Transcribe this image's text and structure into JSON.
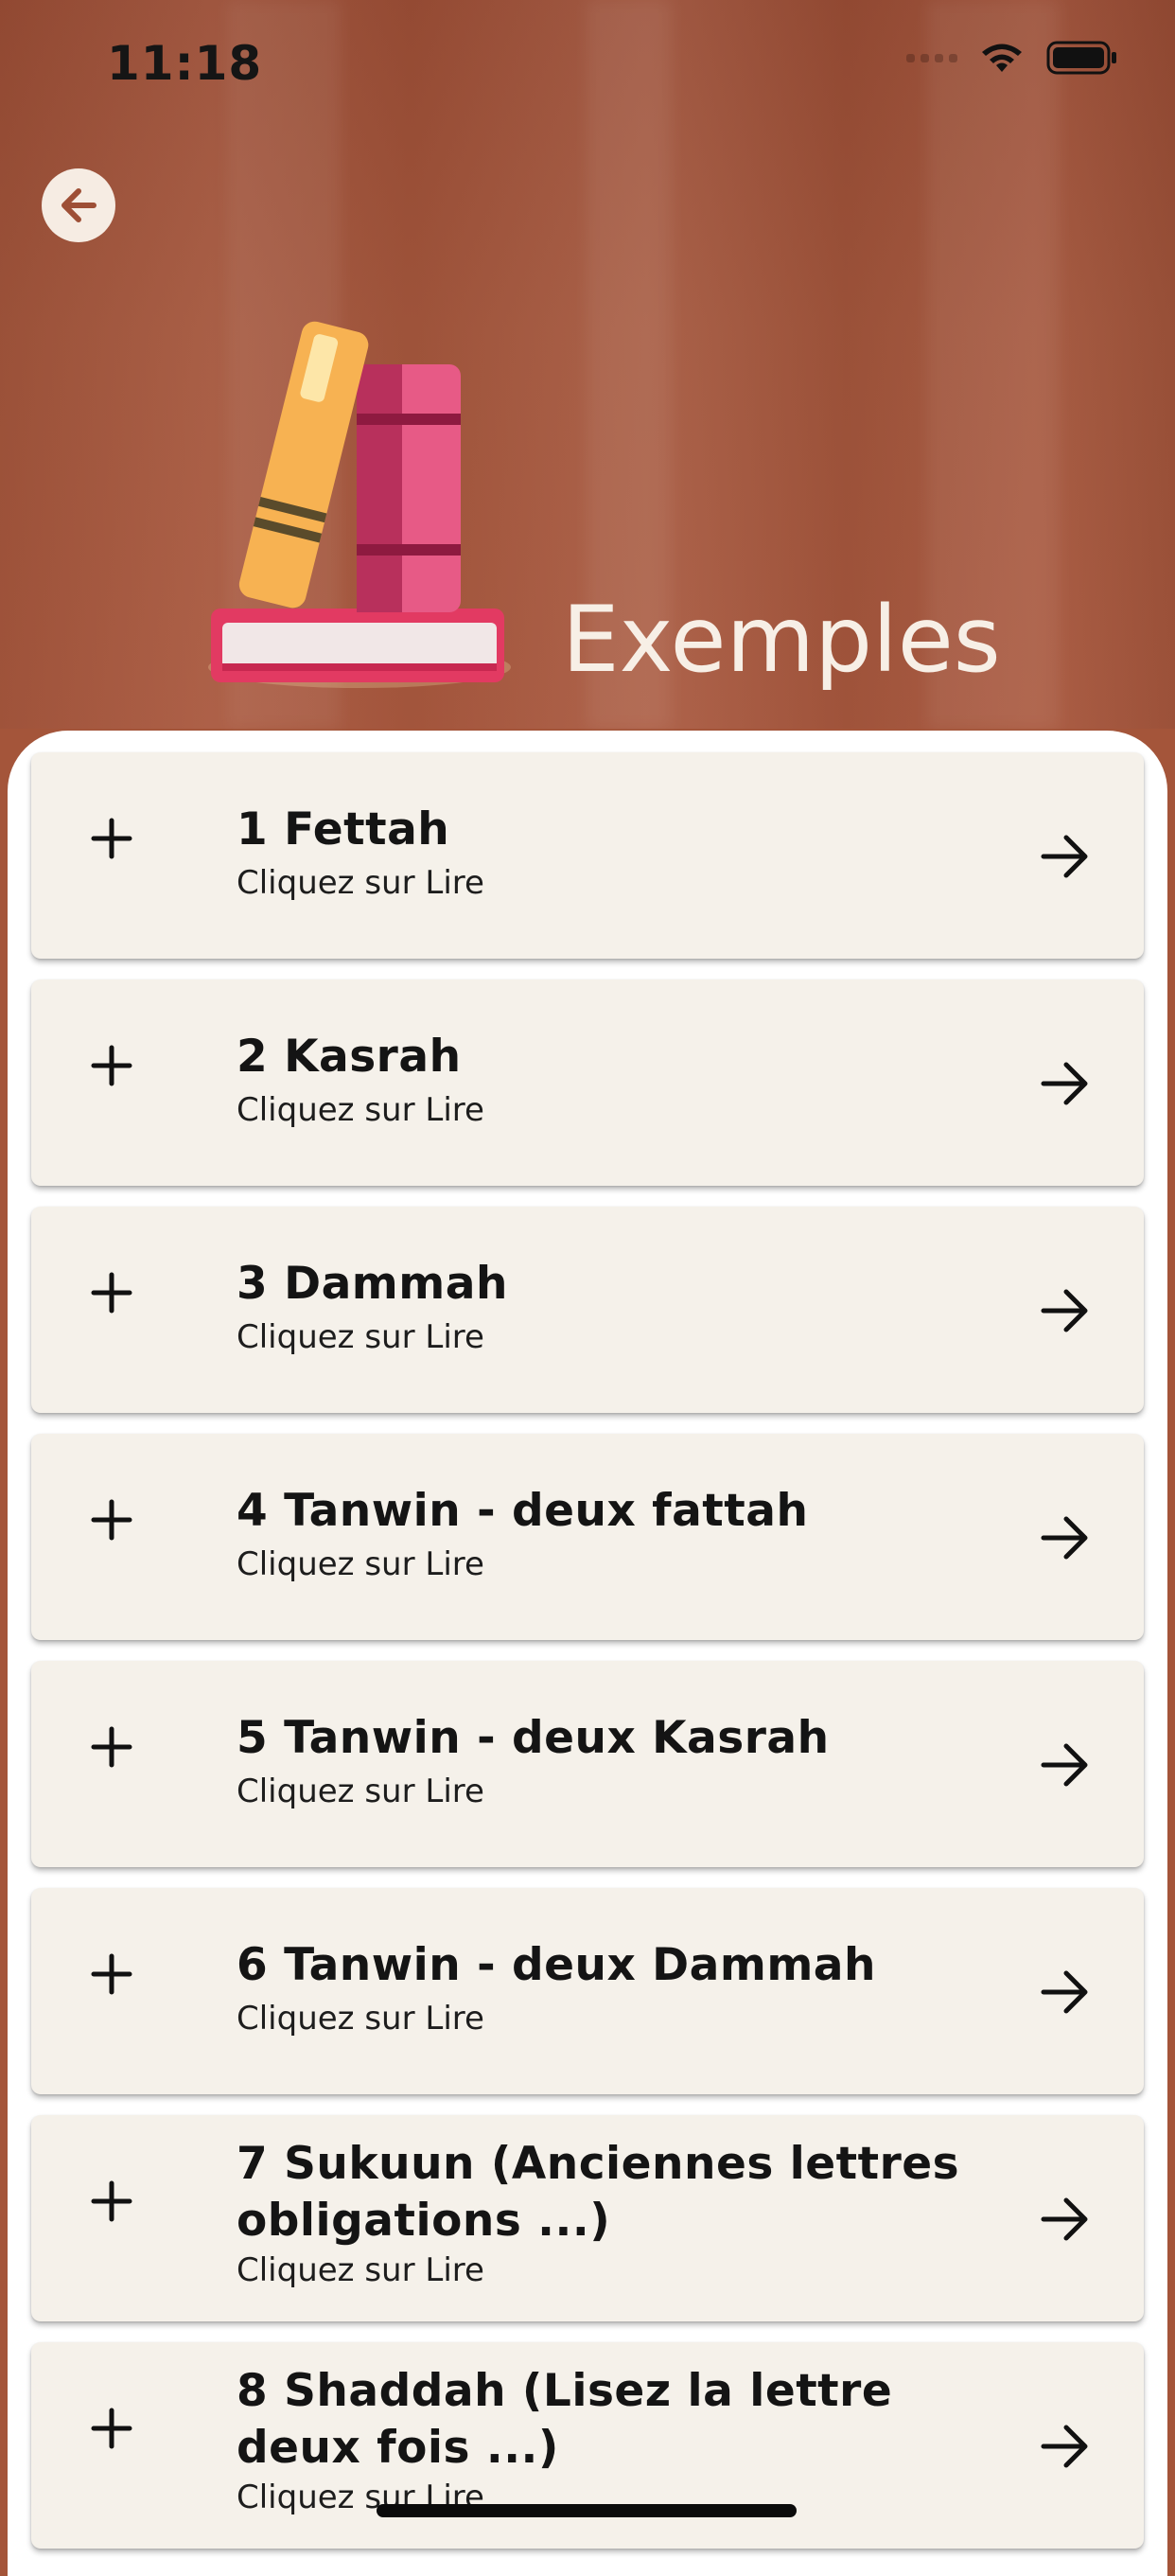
{
  "status_bar": {
    "time": "11:18"
  },
  "header": {
    "title": "Exemples",
    "back_icon": "arrow-left-circle-icon",
    "logo_icon": "books-icon"
  },
  "items": [
    {
      "title": "1 Fettah",
      "subtitle": "Cliquez sur Lire"
    },
    {
      "title": "2 Kasrah",
      "subtitle": "Cliquez sur Lire"
    },
    {
      "title": "3 Dammah",
      "subtitle": "Cliquez sur Lire"
    },
    {
      "title": "4 Tanwin - deux fattah",
      "subtitle": "Cliquez sur Lire"
    },
    {
      "title": "5 Tanwin - deux Kasrah",
      "subtitle": "Cliquez sur Lire"
    },
    {
      "title": "6 Tanwin - deux Dammah",
      "subtitle": "Cliquez sur Lire"
    },
    {
      "title": "7 Sukuun (Anciennes lettres obligations ...)",
      "subtitle": "Cliquez sur Lire"
    },
    {
      "title": "8 Shaddah (Lisez la lettre deux fois ...)",
      "subtitle": "Cliquez sur Lire"
    }
  ],
  "colors": {
    "header_background": "#a4553a",
    "card_background": "#f5f1ea",
    "title_text": "#f7efe6",
    "text_dark": "#141414"
  }
}
